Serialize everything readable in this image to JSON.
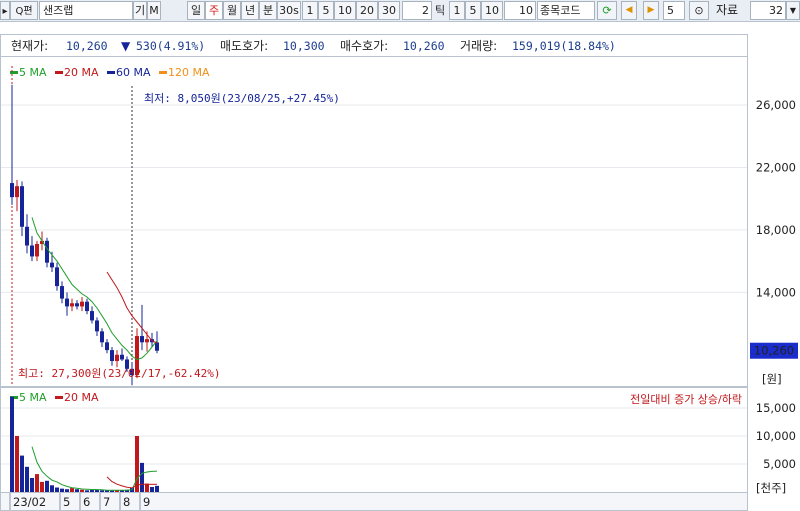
{
  "toolbar": {
    "search_icon_label": "Q",
    "search_label": "편",
    "stock_name": "샌즈랩",
    "btn_gi": "기",
    "btn_m": "M",
    "period_tabs": [
      "일",
      "주",
      "월",
      "년",
      "분",
      "30s"
    ],
    "active_period": "주",
    "minute_options_a": [
      "1",
      "5",
      "10",
      "20",
      "30"
    ],
    "tick_value": "2",
    "tick_label": "틱",
    "minute_options_b": [
      "1",
      "5",
      "10"
    ],
    "count_value": "10",
    "code_placeholder": "종목코드",
    "step_value": "5",
    "data_label": "자료",
    "data_count": "32"
  },
  "info": {
    "price_label": "현재가:",
    "price": "10,260",
    "change_arrow": "▼",
    "change": "530(4.91%)",
    "ask_label": "매도호가:",
    "ask": "10,300",
    "bid_label": "매수호가:",
    "bid": "10,260",
    "volume_label": "거래량:",
    "volume": "159,019(18.84%)"
  },
  "price_legend": [
    {
      "label": "5 MA",
      "color": "#1f9e2a"
    },
    {
      "label": "20 MA",
      "color": "#c0181b"
    },
    {
      "label": "60 MA",
      "color": "#16249a"
    },
    {
      "label": "120 MA",
      "color": "#f0901a"
    }
  ],
  "volume_legend": [
    {
      "label": "5 MA",
      "color": "#1f9e2a"
    },
    {
      "label": "20 MA",
      "color": "#c0181b"
    }
  ],
  "annotations": {
    "low": "최저: 8,050원(23/08/25,+27.45%)",
    "high": "최고: 27,300원(23/02/17,-62.42%)",
    "volume_note": "전일대비 증가 상승/하락"
  },
  "axes": {
    "price_unit": "[원]",
    "volume_unit": "[천주]",
    "current_price_tag": "10,260"
  },
  "colors": {
    "up": "#c0181b",
    "down": "#16249a",
    "ma5": "#1f9e2a",
    "ma20": "#c0181b",
    "price_tag_bg": "#1a2ccc"
  },
  "chart_data": [
    {
      "type": "candlestick",
      "title": "",
      "xlabel": "",
      "ylabel": "[원]",
      "ylim": [
        8000,
        28500
      ],
      "yticks": [
        14000,
        18000,
        22000,
        26000
      ],
      "ytick_labels": [
        "14,000",
        "18,000",
        "22,000",
        "26,000"
      ],
      "candles": [
        {
          "o": 21000,
          "h": 27300,
          "l": 19600,
          "c": 20100
        },
        {
          "o": 20100,
          "h": 21200,
          "l": 19200,
          "c": 20800
        },
        {
          "o": 20800,
          "h": 21100,
          "l": 17600,
          "c": 18200
        },
        {
          "o": 18200,
          "h": 19000,
          "l": 16500,
          "c": 17000
        },
        {
          "o": 17000,
          "h": 17600,
          "l": 16000,
          "c": 16300
        },
        {
          "o": 16300,
          "h": 17300,
          "l": 16000,
          "c": 17100
        },
        {
          "o": 17100,
          "h": 17900,
          "l": 16700,
          "c": 17300
        },
        {
          "o": 17300,
          "h": 17500,
          "l": 15600,
          "c": 15900
        },
        {
          "o": 15900,
          "h": 16600,
          "l": 15300,
          "c": 15600
        },
        {
          "o": 15600,
          "h": 15900,
          "l": 14100,
          "c": 14400
        },
        {
          "o": 14400,
          "h": 14700,
          "l": 13300,
          "c": 13600
        },
        {
          "o": 13600,
          "h": 14000,
          "l": 12500,
          "c": 13100
        },
        {
          "o": 13100,
          "h": 13600,
          "l": 12800,
          "c": 13300
        },
        {
          "o": 13300,
          "h": 13500,
          "l": 12900,
          "c": 13100
        },
        {
          "o": 13100,
          "h": 13700,
          "l": 12800,
          "c": 13400
        },
        {
          "o": 13400,
          "h": 13600,
          "l": 12600,
          "c": 12800
        },
        {
          "o": 12800,
          "h": 13100,
          "l": 12000,
          "c": 12200
        },
        {
          "o": 12200,
          "h": 12400,
          "l": 11200,
          "c": 11500
        },
        {
          "o": 11500,
          "h": 11700,
          "l": 10500,
          "c": 10800
        },
        {
          "o": 10800,
          "h": 11000,
          "l": 10100,
          "c": 10300
        },
        {
          "o": 10300,
          "h": 10500,
          "l": 9300,
          "c": 9600
        },
        {
          "o": 9600,
          "h": 10300,
          "l": 9200,
          "c": 10000
        },
        {
          "o": 10000,
          "h": 10400,
          "l": 9600,
          "c": 9700
        },
        {
          "o": 9700,
          "h": 9900,
          "l": 8900,
          "c": 9100
        },
        {
          "o": 9100,
          "h": 9500,
          "l": 8050,
          "c": 8700
        },
        {
          "o": 8700,
          "h": 11700,
          "l": 8500,
          "c": 11200
        },
        {
          "o": 11200,
          "h": 13200,
          "l": 10300,
          "c": 10800
        },
        {
          "o": 10800,
          "h": 11500,
          "l": 10200,
          "c": 11000
        },
        {
          "o": 11000,
          "h": 11400,
          "l": 10500,
          "c": 10800
        },
        {
          "o": 10790,
          "h": 11500,
          "l": 10100,
          "c": 10260
        }
      ],
      "ma5": [
        null,
        null,
        null,
        null,
        18800,
        17800,
        17300,
        16800,
        16400,
        16000,
        15500,
        15000,
        14500,
        14200,
        13900,
        13700,
        13400,
        13000,
        12500,
        12000,
        11400,
        11000,
        10600,
        10300,
        9900,
        9700,
        9800,
        10100,
        10500,
        10900
      ],
      "ma20": [
        null,
        null,
        null,
        null,
        null,
        null,
        null,
        null,
        null,
        null,
        null,
        null,
        null,
        null,
        null,
        null,
        null,
        null,
        null,
        15300,
        14800,
        14300,
        13700,
        13000,
        12500,
        12100,
        11700,
        11300,
        10900,
        10750
      ]
    },
    {
      "type": "bar",
      "title": "",
      "ylabel": "[천주]",
      "ylim": [
        0,
        17500
      ],
      "yticks": [
        5000,
        10000,
        15000
      ],
      "ytick_labels": [
        "5,000",
        "10,000",
        "15,000"
      ],
      "volume": [
        17000,
        10000,
        6500,
        4500,
        2500,
        3200,
        1800,
        2000,
        1200,
        800,
        600,
        500,
        700,
        500,
        400,
        300,
        350,
        400,
        300,
        300,
        250,
        350,
        300,
        400,
        800,
        10000,
        5200,
        1500,
        900,
        1100
      ],
      "vol_ma5": [
        null,
        null,
        null,
        null,
        8100,
        5300,
        3700,
        2800,
        2100,
        1800,
        1300,
        1000,
        760,
        660,
        540,
        480,
        450,
        430,
        390,
        330,
        320,
        320,
        300,
        320,
        420,
        2370,
        3340,
        3580,
        3680,
        3740
      ],
      "vol_ma20": [
        null,
        null,
        null,
        null,
        null,
        null,
        null,
        null,
        null,
        null,
        null,
        null,
        null,
        null,
        null,
        null,
        null,
        null,
        null,
        2700,
        1860,
        1390,
        1090,
        860,
        740,
        1230,
        1380,
        1380,
        1360,
        1380
      ]
    }
  ],
  "x_axis": {
    "ticks": [
      {
        "index": 0,
        "label": "23/02"
      },
      {
        "index": 10,
        "label": "5"
      },
      {
        "index": 14,
        "label": "6"
      },
      {
        "index": 18,
        "label": "7"
      },
      {
        "index": 22,
        "label": "8"
      },
      {
        "index": 26,
        "label": "9"
      }
    ]
  }
}
